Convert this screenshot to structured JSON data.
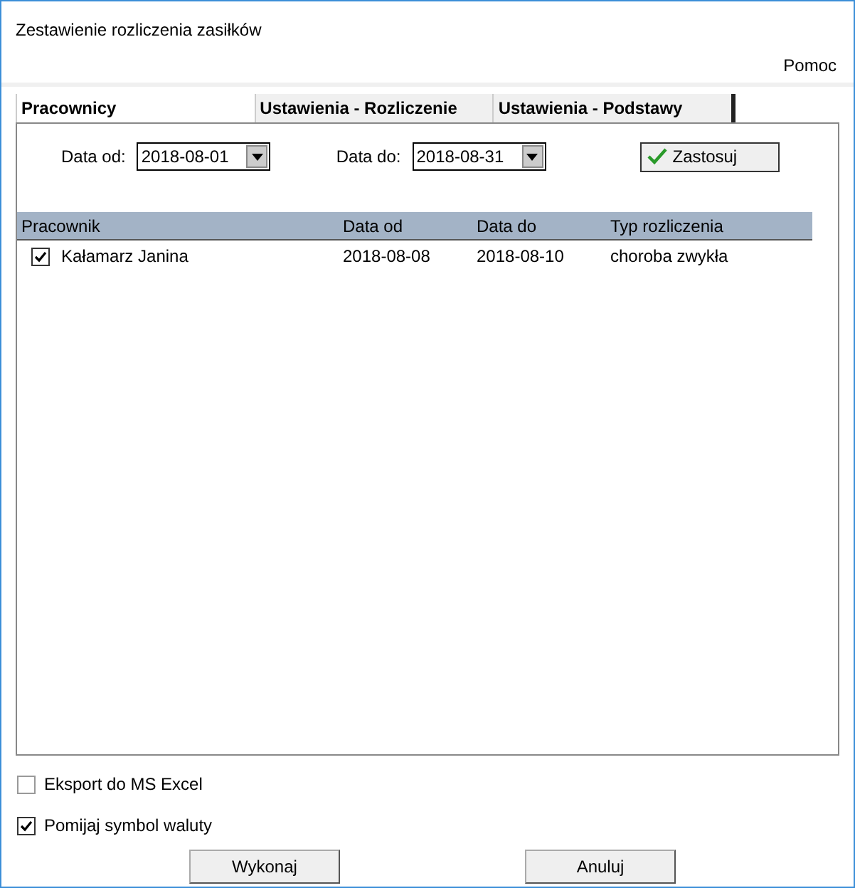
{
  "window": {
    "title": "Zestawienie rozliczenia zasiłków"
  },
  "menu": [
    "Pomoc"
  ],
  "tabs": [
    {
      "label": "Pracownicy",
      "selected": true
    },
    {
      "label": "Ustawienia - Rozliczenie",
      "selected": false
    },
    {
      "label": "Ustawienia - Podstawy",
      "selected": false
    }
  ],
  "filters": [
    {
      "label": "Data od:",
      "value": "2018-08-01"
    },
    {
      "label": "Data do:",
      "value": "2018-08-31"
    }
  ],
  "apply_button": "Zastosuj",
  "table": {
    "columns": [
      "Pracownik",
      "Data od",
      "Data do",
      "Typ rozliczenia"
    ],
    "rows": [
      {
        "checked": true,
        "cells": [
          "Kałamarz Janina",
          "2018-08-08",
          "2018-08-10",
          "choroba zwykła"
        ]
      }
    ]
  },
  "options": [
    {
      "label": "Eksport do MS Excel",
      "checked": false
    },
    {
      "label": "Pomijaj symbol waluty",
      "checked": true
    }
  ],
  "buttons": [
    "Wykonaj",
    "Anuluj"
  ]
}
